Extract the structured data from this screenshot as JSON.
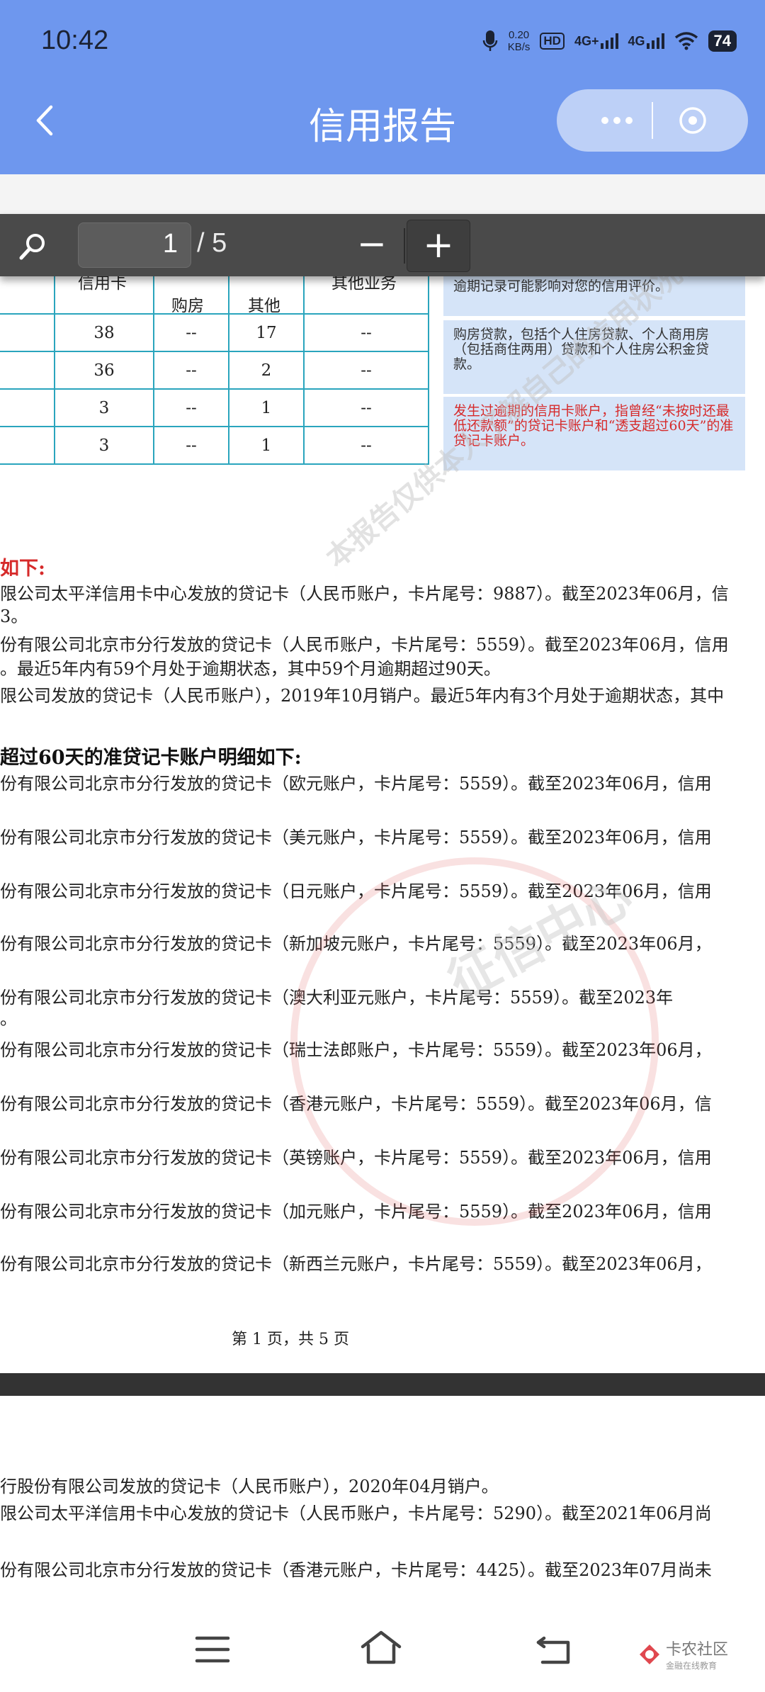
{
  "status": {
    "time": "10:42",
    "net_speed_value": "0.20",
    "net_speed_unit": "KB/s",
    "hd": "HD",
    "sim1": "4G+",
    "sim2": "4G",
    "battery": "74"
  },
  "header": {
    "title": "信用报告"
  },
  "viewer": {
    "page_current": "1",
    "page_total": "/ 5",
    "zoom_out": "−",
    "zoom_in": "+"
  },
  "table": {
    "headers": {
      "card": "信用卡",
      "house": "购房",
      "other": "其他",
      "other_business": "其他业务"
    },
    "rows": [
      {
        "card": "38",
        "house": "--",
        "other": "17",
        "biz": "--"
      },
      {
        "card": "36",
        "house": "--",
        "other": "2",
        "biz": "--"
      },
      {
        "card": "3",
        "house": "--",
        "other": "1",
        "biz": "--"
      },
      {
        "card": "3",
        "house": "--",
        "other": "1",
        "biz": "--"
      }
    ]
  },
  "notes": {
    "top": "逾期记录可能影响对您的信用评价。",
    "house": "购房贷款，包括个人住房贷款、个人商用房（包括商住两用）贷款和个人住房公积金贷款。",
    "overdue": "发生过逾期的信用卡账户，指曾经“未按时还最低还款额”的贷记卡账户和“透支超过60天”的准贷记卡账户。"
  },
  "section1": {
    "heading": "如下:",
    "lines": [
      "限公司太平洋信用卡中心发放的贷记卡（人民币账户，卡片尾号：9887）。截至2023年06月，信",
      "3。",
      "份有限公司北京市分行发放的贷记卡（人民币账户，卡片尾号：5559）。截至2023年06月，信用",
      "。最近5年内有59个月处于逾期状态，其中59个月逾期超过90天。",
      "限公司发放的贷记卡（人民币账户），2019年10月销户。最近5年内有3个月处于逾期状态，其中"
    ]
  },
  "section2": {
    "heading": "超过60天的准贷记卡账户明细如下:",
    "lines": [
      "份有限公司北京市分行发放的贷记卡（欧元账户，卡片尾号：5559）。截至2023年06月，信用",
      "份有限公司北京市分行发放的贷记卡（美元账户，卡片尾号：5559）。截至2023年06月，信用",
      "份有限公司北京市分行发放的贷记卡（日元账户，卡片尾号：5559）。截至2023年06月，信用",
      "份有限公司北京市分行发放的贷记卡（新加坡元账户，卡片尾号：5559）。截至2023年06月，",
      "份有限公司北京市分行发放的贷记卡（澳大利亚元账户，卡片尾号：5559）。截至2023年",
      "。",
      "份有限公司北京市分行发放的贷记卡（瑞士法郎账户，卡片尾号：5559）。截至2023年06月，",
      "份有限公司北京市分行发放的贷记卡（香港元账户，卡片尾号：5559）。截至2023年06月，信",
      "份有限公司北京市分行发放的贷记卡（英镑账户，卡片尾号：5559）。截至2023年06月，信用",
      "份有限公司北京市分行发放的贷记卡（加元账户，卡片尾号：5559）。截至2023年06月，信用",
      "份有限公司北京市分行发放的贷记卡（新西兰元账户，卡片尾号：5559）。截至2023年06月，"
    ]
  },
  "page_footer": "第 1 页，共 5 页",
  "page2": {
    "lines": [
      "行股份有限公司发放的贷记卡（人民币账户），2020年04月销户。",
      "限公司太平洋信用卡中心发放的贷记卡（人民币账户，卡片尾号：5290）。截至2021年06月尚",
      "份有限公司北京市分行发放的贷记卡（香港元账户，卡片尾号：4425）。截至2023年07月尚未"
    ]
  },
  "watermarks": {
    "seal": "征信中心",
    "diagonal": "本报告仅供本人了解自己的信用状况使用"
  },
  "navbar": {
    "brand": "卡农社区",
    "brand_sub": "金融在线教育"
  },
  "colors": {
    "header_bg": "#6e97ee",
    "table_border": "#2aa5bd",
    "note_bg": "#d5e4f8",
    "alert_red": "#d62a2a",
    "toolbar_bg": "#4a4a4a"
  }
}
